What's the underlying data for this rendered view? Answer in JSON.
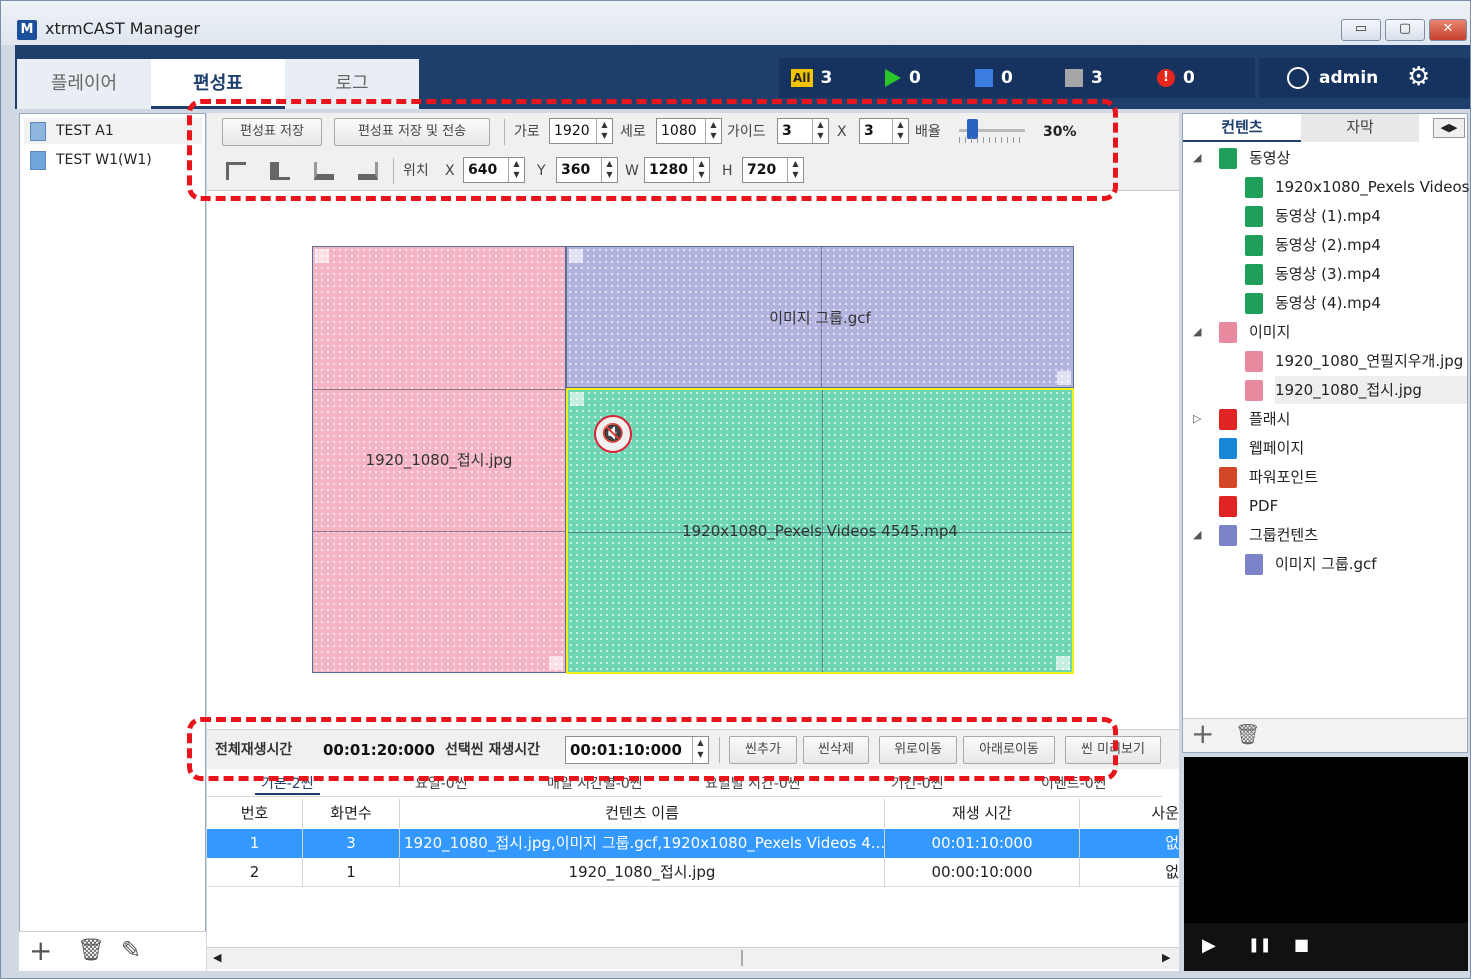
{
  "window": {
    "title": "xtrmCAST Manager",
    "logo_letter": "M",
    "btn_min": "▭",
    "btn_max": "▢",
    "btn_close": "✕"
  },
  "header": {
    "tabs": [
      {
        "label": "플레이어"
      },
      {
        "label": "편성표"
      },
      {
        "label": "로그"
      }
    ],
    "status": {
      "all_label": "All",
      "all_count": "3",
      "playing_count": "0",
      "stopped_count": "0",
      "off_count": "3",
      "error_count": "0"
    },
    "user": {
      "name": "admin"
    }
  },
  "left_panel": {
    "items": [
      {
        "label": "TEST A1"
      },
      {
        "label": "TEST W1(W1)"
      }
    ],
    "footer": {
      "add": "+",
      "delete": "🗑",
      "edit": "✎"
    }
  },
  "toolbar": {
    "save_label": "편성표 저장",
    "save_send_label": "편성표 저장 및 전송",
    "width_label": "가로",
    "width_value": "1920",
    "height_label": "세로",
    "height_value": "1080",
    "guide_label": "가이드",
    "guide_x": "3",
    "x_sep": "X",
    "guide_y": "3",
    "zoom_label": "배율",
    "zoom_value": "30%",
    "pos_label": "위치",
    "x_label": "X",
    "x_value": "640",
    "y_label": "Y",
    "y_value": "360",
    "w_label": "W",
    "w_value": "1280",
    "h_label": "H",
    "h_value": "720"
  },
  "canvas": {
    "zones": [
      {
        "label": "1920_1080_접시.jpg",
        "color": "#f4b4c4"
      },
      {
        "label": "이미지 그룹.gcf",
        "color": "#b3b3e0"
      },
      {
        "label": "1920x1080_Pexels Videos 4545.mp4",
        "color": "#6ed6b4"
      }
    ],
    "mute_icon": "🔇"
  },
  "scene_bar": {
    "total_label": "전체재생시간",
    "total_value": "00:01:20:000",
    "selected_label": "선택씬 재생시간",
    "selected_value": "00:01:10:000",
    "add_scene": "씬추가",
    "delete_scene": "씬삭제",
    "move_up": "위로이동",
    "move_down": "아래로이동",
    "preview": "씬 미리보기"
  },
  "sub_tabs": [
    {
      "label": "기본-2씬"
    },
    {
      "label": "요일-0씬"
    },
    {
      "label": "매일 시간별-0씬"
    },
    {
      "label": "요일별 시간-0씬"
    },
    {
      "label": "기간-0씬"
    },
    {
      "label": "이벤트-0씬"
    }
  ],
  "table": {
    "headers": [
      "번호",
      "화면수",
      "컨텐츠 이름",
      "재생 시간",
      "사운"
    ],
    "rows": [
      {
        "no": "1",
        "screens": "3",
        "name": "1920_1080_접시.jpg,이미지 그룹.gcf,1920x1080_Pexels Videos 4...",
        "time": "00:01:10:000",
        "sound": "없"
      },
      {
        "no": "2",
        "screens": "1",
        "name": "1920_1080_접시.jpg",
        "time": "00:00:10:000",
        "sound": "없"
      }
    ]
  },
  "right_panel": {
    "tabs": [
      {
        "label": "컨텐츠"
      },
      {
        "label": "자막"
      }
    ],
    "tree": [
      {
        "label": "동영상",
        "level": 0,
        "kind": "video",
        "expander": "◢"
      },
      {
        "label": "1920x1080_Pexels Videos...",
        "level": 1,
        "kind": "video",
        "expander": "▷"
      },
      {
        "label": "동영상 (1).mp4",
        "level": 1,
        "kind": "video",
        "expander": "▷"
      },
      {
        "label": "동영상 (2).mp4",
        "level": 1,
        "kind": "video",
        "expander": "▷"
      },
      {
        "label": "동영상 (3).mp4",
        "level": 1,
        "kind": "video",
        "expander": "▷"
      },
      {
        "label": "동영상 (4).mp4",
        "level": 1,
        "kind": "video",
        "expander": "▷"
      },
      {
        "label": "이미지",
        "level": 0,
        "kind": "image",
        "expander": "◢"
      },
      {
        "label": "1920_1080_연필지우개.jpg",
        "level": 1,
        "kind": "image",
        "expander": "▷"
      },
      {
        "label": "1920_1080_접시.jpg",
        "level": 1,
        "kind": "image",
        "expander": "▷"
      },
      {
        "label": "플래시",
        "level": 0,
        "kind": "flash",
        "expander": "▷"
      },
      {
        "label": "웹페이지",
        "level": 0,
        "kind": "web",
        "expander": ""
      },
      {
        "label": "파워포인트",
        "level": 0,
        "kind": "ppt",
        "expander": ""
      },
      {
        "label": "PDF",
        "level": 0,
        "kind": "pdf",
        "expander": ""
      },
      {
        "label": "그룹컨텐츠",
        "level": 0,
        "kind": "group",
        "expander": "◢"
      },
      {
        "label": "이미지 그룹.gcf",
        "level": 1,
        "kind": "group",
        "expander": "▷"
      }
    ],
    "footer": {
      "add": "+",
      "delete": "🗑"
    }
  },
  "preview": {
    "play": "▶",
    "pause": "❚❚",
    "stop": "■"
  },
  "colors": {
    "header": "#1e3e6b",
    "selected_row": "#3399ff",
    "video": "#1fa05a",
    "image": "#e88a9e",
    "group": "#7b82c8"
  }
}
